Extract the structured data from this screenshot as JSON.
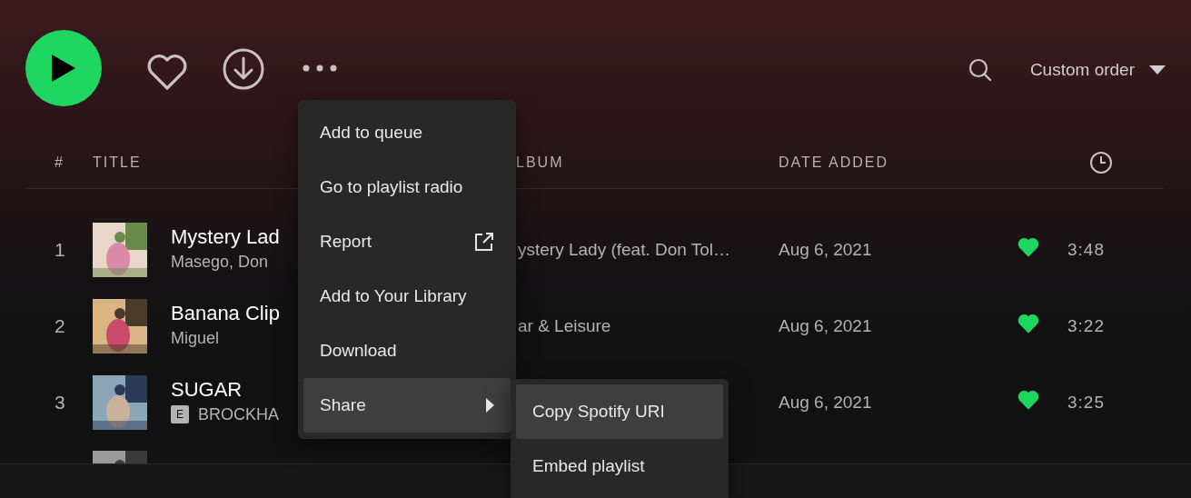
{
  "toolbar": {
    "liked": false,
    "sort_label": "Custom order"
  },
  "columns": [
    {
      "label": "#"
    },
    {
      "label": "TITLE"
    },
    {
      "label": "LBUM"
    },
    {
      "label": "DATE ADDED"
    }
  ],
  "tracks": [
    {
      "number": "1",
      "title": "Mystery Lad",
      "artist": "Masego, Don",
      "explicit": false,
      "album": "ystery Lady (feat. Don Tol…",
      "date_added": "Aug 6, 2021",
      "liked": true,
      "duration": "3:48"
    },
    {
      "number": "2",
      "title": "Banana Clip",
      "artist": "Miguel",
      "explicit": false,
      "album": "ar & Leisure",
      "date_added": "Aug 6, 2021",
      "liked": true,
      "duration": "3:22"
    },
    {
      "number": "3",
      "title": "SUGAR",
      "artist": "BROCKHA",
      "explicit": true,
      "badge": "E",
      "date_added": "Aug 6, 2021",
      "liked": true,
      "duration": "3:25"
    }
  ],
  "context_menu": {
    "items": [
      {
        "label": "Add to queue",
        "kind": "item",
        "selected": false
      },
      {
        "label": "Go to playlist radio",
        "kind": "item",
        "selected": false
      },
      {
        "label": "Report",
        "kind": "external",
        "selected": false
      },
      {
        "label": "Add to Your Library",
        "kind": "item",
        "selected": false
      },
      {
        "label": "Download",
        "kind": "item",
        "selected": false
      },
      {
        "label": "Share",
        "kind": "submenu",
        "selected": true
      }
    ],
    "submenu": [
      {
        "label": "Copy Spotify URI",
        "selected": true
      },
      {
        "label": "Embed playlist",
        "selected": false
      }
    ]
  }
}
